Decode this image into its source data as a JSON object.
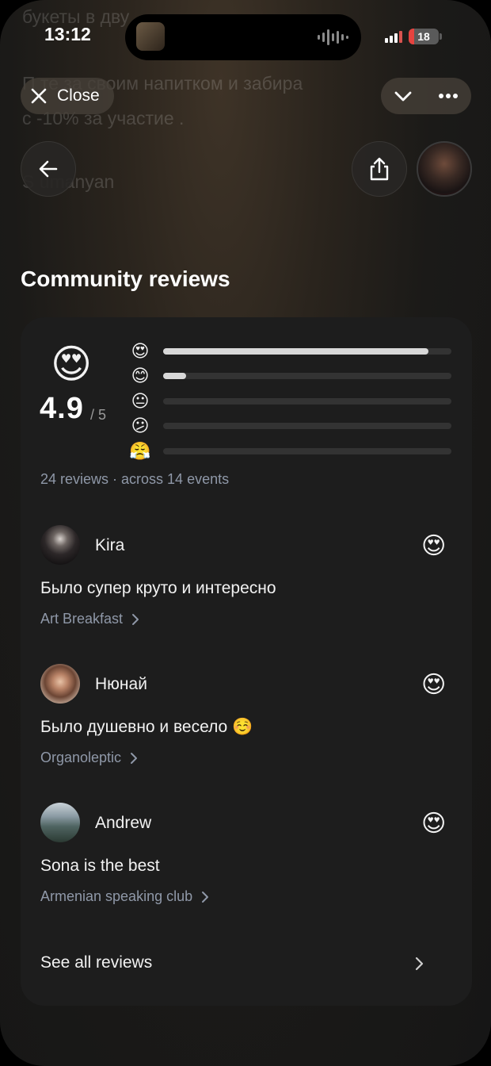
{
  "status_bar": {
    "time": "13:12",
    "battery": "18"
  },
  "background_text": {
    "line1": "букеты в дву",
    "line2": "П           те за своим напитком и забира",
    "line3": "с -10% за участие .",
    "line4": "S      umanyan"
  },
  "top_controls": {
    "close_label": "Close"
  },
  "section": {
    "title": "Community reviews"
  },
  "rating": {
    "emoji": "😍",
    "score": "4.9",
    "max": "/ 5",
    "summary": "24 reviews · across 14 events",
    "distribution": [
      {
        "emoji": "😍",
        "fill": 0.92
      },
      {
        "emoji": "😊",
        "fill": 0.08
      },
      {
        "emoji": "😐",
        "fill": 0.0
      },
      {
        "emoji": "😕",
        "fill": 0.0
      },
      {
        "emoji": "😤",
        "fill": 0.0
      }
    ]
  },
  "reviews": [
    {
      "name": "Kira",
      "emoji": "😍",
      "text": "Было супер круто и интересно",
      "event": "Art Breakfast"
    },
    {
      "name": "Нюнай",
      "emoji": "😍",
      "text": "Было душевно и весело ☺️",
      "event": "Organoleptic"
    },
    {
      "name": "Andrew",
      "emoji": "😍",
      "text": "Sona is the best",
      "event": "Armenian speaking club"
    }
  ],
  "see_all_label": "See all reviews",
  "colors": {
    "card": "#1d1d1d",
    "muted": "#8f98a8",
    "bar_fill": "#d8d8d8"
  }
}
